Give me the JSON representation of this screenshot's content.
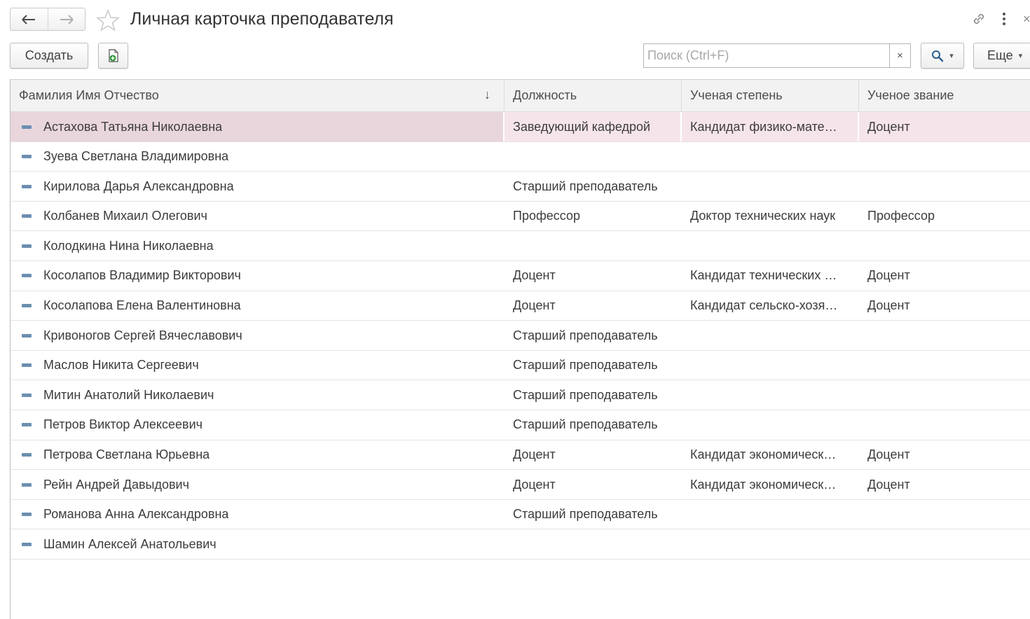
{
  "window": {
    "title": "Личная карточка преподавателя",
    "nav_back_icon": "arrow-left",
    "nav_forward_icon": "arrow-right",
    "close_label": "×"
  },
  "toolbar": {
    "create_label": "Создать",
    "search_placeholder": "Поиск (Ctrl+F)",
    "search_value": "",
    "clear_label": "×",
    "more_label": "Еще",
    "caret": "▾"
  },
  "table": {
    "columns": [
      {
        "label": "Фамилия Имя Отчество",
        "sort": "↓"
      },
      {
        "label": "Должность"
      },
      {
        "label": "Ученая степень"
      },
      {
        "label": "Ученое звание"
      }
    ],
    "rows": [
      {
        "name": "Астахова Татьяна Николаевна",
        "position": "Заведующий кафедрой",
        "degree": "Кандидат физико-мате…",
        "title": "Доцент",
        "selected": true
      },
      {
        "name": "Зуева Светлана Владимировна",
        "position": "",
        "degree": "",
        "title": ""
      },
      {
        "name": "Кирилова Дарья Александровна",
        "position": "Старший преподаватель",
        "degree": "",
        "title": ""
      },
      {
        "name": "Колбанев Михаил Олегович",
        "position": "Профессор",
        "degree": "Доктор технических наук",
        "title": "Профессор"
      },
      {
        "name": "Колодкина Нина Николаевна",
        "position": "",
        "degree": "",
        "title": ""
      },
      {
        "name": "Косолапов Владимир Викторович",
        "position": "Доцент",
        "degree": "Кандидат технических …",
        "title": "Доцент"
      },
      {
        "name": "Косолапова Елена Валентиновна",
        "position": "Доцент",
        "degree": "Кандидат сельско-хозя…",
        "title": "Доцент"
      },
      {
        "name": "Кривоногов Сергей Вячеславович",
        "position": "Старший преподаватель",
        "degree": "",
        "title": ""
      },
      {
        "name": "Маслов Никита Сергеевич",
        "position": "Старший преподаватель",
        "degree": "",
        "title": ""
      },
      {
        "name": "Митин Анатолий Николаевич",
        "position": "Старший преподаватель",
        "degree": "",
        "title": ""
      },
      {
        "name": "Петров Виктор Алексеевич",
        "position": "Старший преподаватель",
        "degree": "",
        "title": ""
      },
      {
        "name": "Петрова Светлана Юрьевна",
        "position": "Доцент",
        "degree": "Кандидат экономическ…",
        "title": "Доцент"
      },
      {
        "name": "Рейн Андрей Давыдович",
        "position": "Доцент",
        "degree": "Кандидат экономическ…",
        "title": "Доцент"
      },
      {
        "name": "Романова Анна Александровна",
        "position": "Старший преподаватель",
        "degree": "",
        "title": ""
      },
      {
        "name": "Шамин Алексей Анатольевич",
        "position": "",
        "degree": "",
        "title": ""
      }
    ]
  },
  "colors": {
    "selected_row": "#e9d6dc",
    "row_icon": "#6c8fb0",
    "header_bg": "#f2f2f2"
  }
}
